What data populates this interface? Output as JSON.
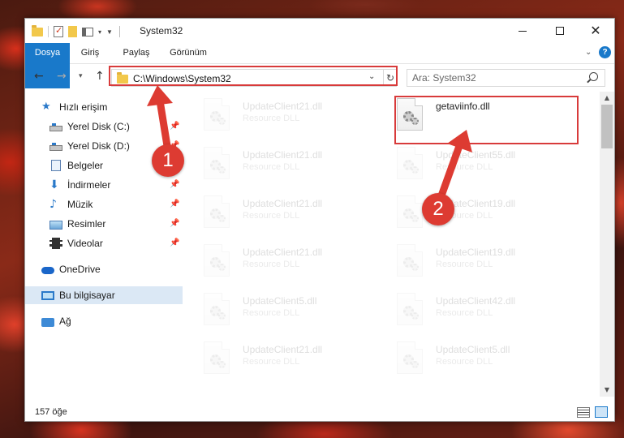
{
  "window": {
    "title": "System32",
    "ribbon_tabs": [
      "Dosya",
      "Giriş",
      "Paylaş",
      "Görünüm"
    ],
    "help_label": "?"
  },
  "navigation": {
    "address_path": "C:\\Windows\\System32",
    "search_placeholder": "Ara: System32"
  },
  "sidebar": {
    "items": [
      {
        "label": "Hızlı erişim",
        "icon": "star-icon"
      },
      {
        "label": "Yerel Disk (C:)",
        "icon": "drive-icon",
        "pinned": true
      },
      {
        "label": "Yerel Disk (D:)",
        "icon": "drive-icon",
        "pinned": true
      },
      {
        "label": "Belgeler",
        "icon": "documents-icon",
        "pinned": true
      },
      {
        "label": "İndirmeler",
        "icon": "downloads-icon",
        "pinned": true
      },
      {
        "label": "Müzik",
        "icon": "music-icon",
        "pinned": true
      },
      {
        "label": "Resimler",
        "icon": "pictures-icon",
        "pinned": true
      },
      {
        "label": "Videolar",
        "icon": "videos-icon",
        "pinned": true
      },
      {
        "label": "OneDrive",
        "icon": "onedrive-icon"
      },
      {
        "label": "Bu bilgisayar",
        "icon": "this-pc-icon",
        "selected": true
      },
      {
        "label": "Ağ",
        "icon": "network-icon"
      }
    ]
  },
  "files": [
    {
      "name": "UpdateClient21.dll",
      "type": "Resource DLL"
    },
    {
      "name": "getaviinfo.dll",
      "type": ""
    },
    {
      "name": "UpdateClient21.dll",
      "type": "Resource DLL"
    },
    {
      "name": "UpdateClient55.dll",
      "type": "Resource DLL"
    },
    {
      "name": "UpdateClient21.dll",
      "type": "Resource DLL"
    },
    {
      "name": "UpdateClient19.dll",
      "type": "Resource DLL"
    },
    {
      "name": "UpdateClient21.dll",
      "type": "Resource DLL"
    },
    {
      "name": "UpdateClient19.dll",
      "type": "Resource DLL"
    },
    {
      "name": "UpdateClient5.dll",
      "type": "Resource DLL"
    },
    {
      "name": "UpdateClient42.dll",
      "type": "Resource DLL"
    },
    {
      "name": "UpdateClient21.dll",
      "type": "Resource DLL"
    },
    {
      "name": "UpdateClient5.dll",
      "type": "Resource DLL"
    }
  ],
  "status": {
    "item_count": "157 öğe"
  },
  "annotations": {
    "step1": "1",
    "step2": "2",
    "color": "#dd3b32"
  }
}
